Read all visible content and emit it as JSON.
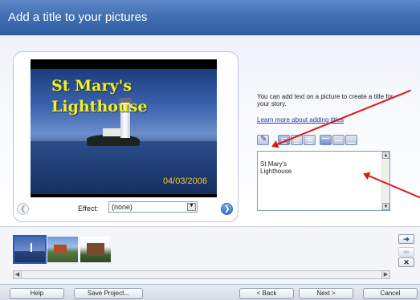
{
  "window": {
    "title": "Add a title to your pictures"
  },
  "photo": {
    "overlay_title": [
      "St Mary's",
      "Lighthouse"
    ],
    "date_stamp": "04/03/2006"
  },
  "effect": {
    "label": "Effect:",
    "value": "(none)"
  },
  "help": {
    "text": "You can add text on a picture to create a title for your story.",
    "link": "Learn more about adding titles"
  },
  "text_editor": {
    "value": "St Mary's\nLighthouse"
  },
  "storyboard": {
    "thumbnails": [
      "lighthouse",
      "houses",
      "castle"
    ],
    "selected_index": 0
  },
  "footer": {
    "help": "Help",
    "save_project": "Save Project...",
    "back": "< Back",
    "next": "Next >",
    "cancel": "Cancel"
  },
  "colors": {
    "title_bar": "#4170b5",
    "overlay_text": "#f2f027",
    "annotation_arrow": "#e01414"
  }
}
